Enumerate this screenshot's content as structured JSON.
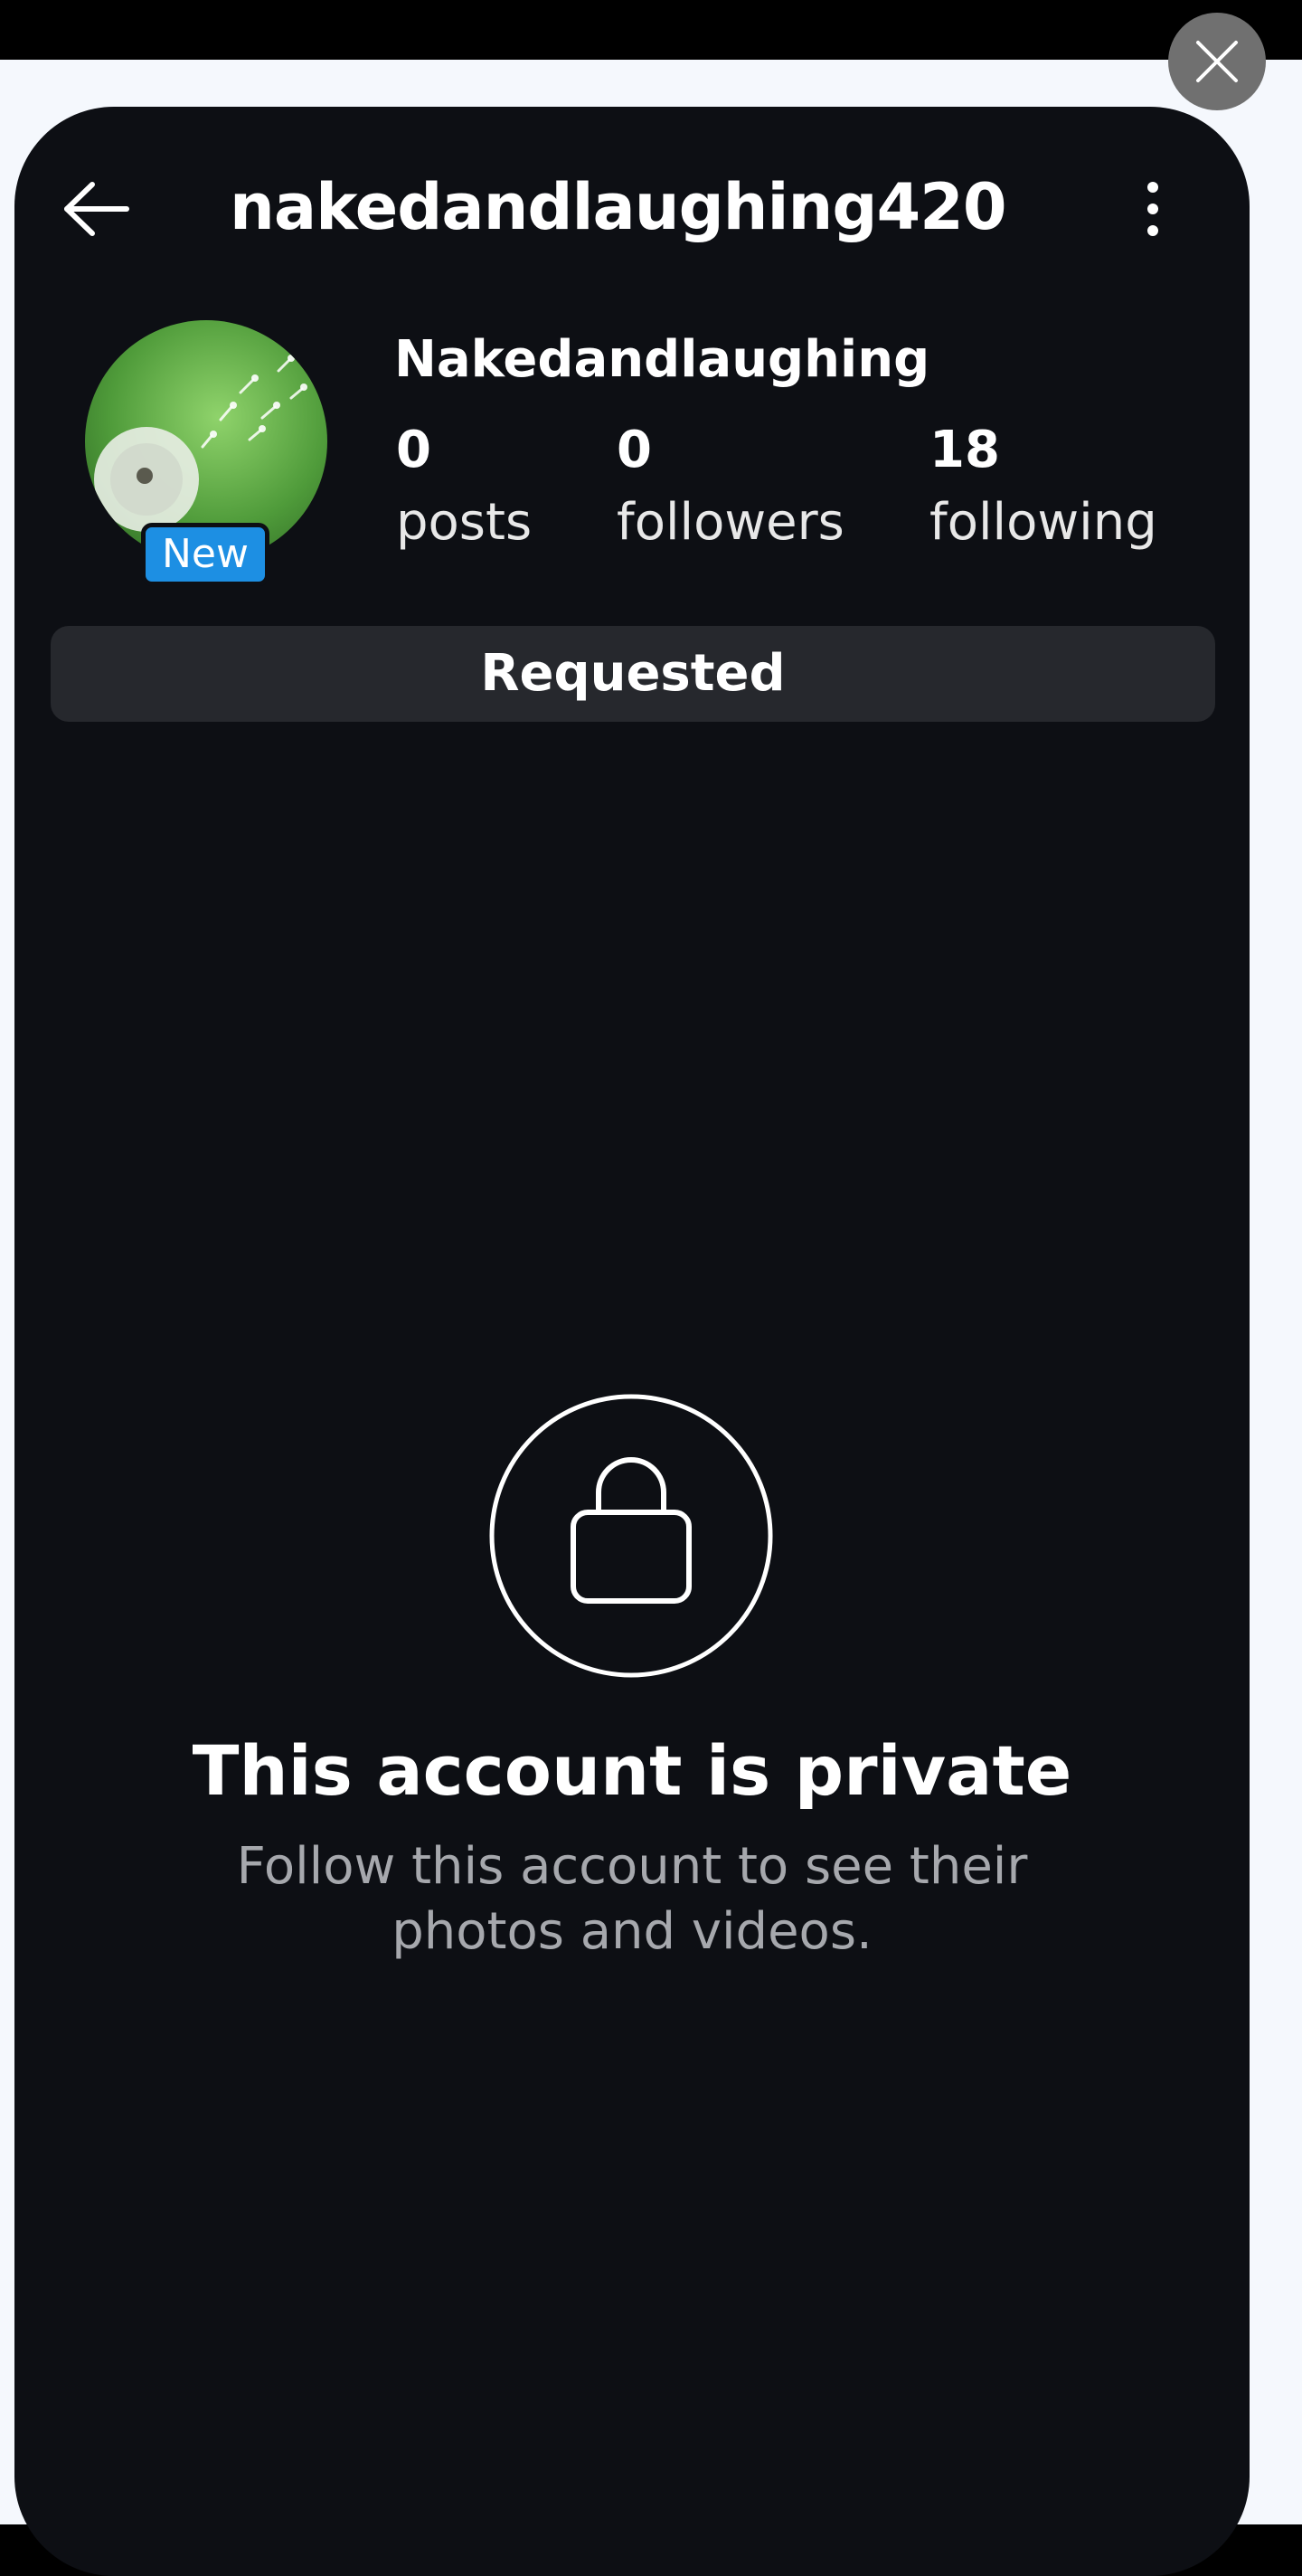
{
  "profile": {
    "username": "nakedandlaughing420",
    "display_name": "Nakedandlaughing",
    "badge": "New",
    "stats": [
      {
        "value": "0",
        "label": "posts"
      },
      {
        "value": "0",
        "label": "followers"
      },
      {
        "value": "18",
        "label": "following"
      }
    ],
    "follow_button": "Requested"
  },
  "private_notice": {
    "title": "This account is private",
    "subtitle": "Follow this account to see their photos and videos."
  },
  "icons": {
    "close": "close-icon",
    "back": "back-arrow-icon",
    "more": "more-options-icon",
    "lock": "lock-icon"
  },
  "colors": {
    "app_background": "#0d0f14",
    "button_background": "#26282d",
    "badge_blue": "#1d8fe3",
    "lightbox_background": "#f5f8fd"
  }
}
